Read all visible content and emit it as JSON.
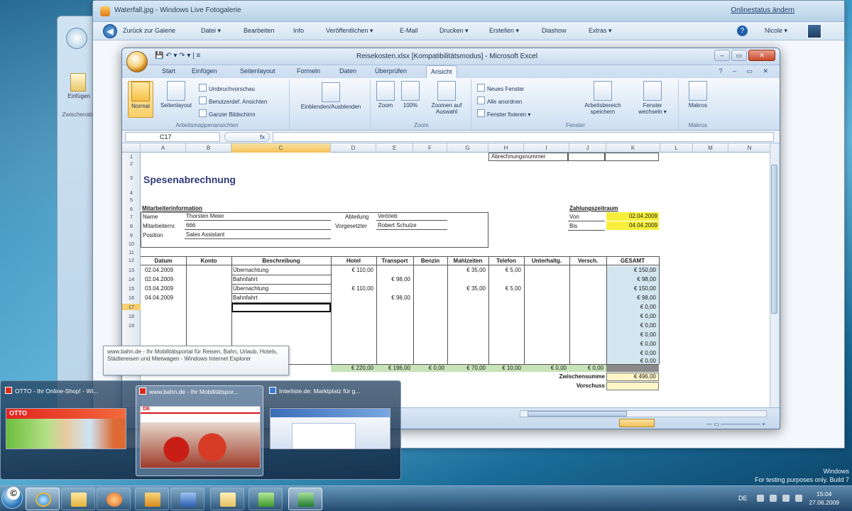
{
  "gallery": {
    "title": "Waterfall.jpg - Windows Live Fotogalerie",
    "online_link": "Onlinestatus ändern",
    "back_label": "Zurück zur Galerie",
    "menu": [
      "Datei ▾",
      "Bearbeiten",
      "Info",
      "Veröffentlichen ▾",
      "E-Mail",
      "Drucken ▾",
      "Erstellen ▾",
      "Diashow",
      "Extras ▾"
    ],
    "signin": "Nicole ▾",
    "side_label": "Einfügen",
    "side_label2": "Zwischenabl."
  },
  "excel": {
    "title": "Reisekosten.xlsx [Kompatibilitätsmodus] - Microsoft Excel",
    "qat": "💾 ↶ ▾  ↷ ▾  |  ≡",
    "tabs": [
      "Start",
      "Einfügen",
      "Seitenlayout",
      "Formeln",
      "Daten",
      "Überprüfen",
      "Ansicht"
    ],
    "active_tab": "Ansicht",
    "ribbon": {
      "normal": "Normal",
      "seitenlayout": "Seitenlayout",
      "umbruch": "Umbruchvorschau",
      "benutzer": "Benutzerdef. Ansichten",
      "ganzer": "Ganzer Bildschirm",
      "group1": "Arbeitsmappenansichten",
      "einblenden": "Einblenden/Ausblenden",
      "zoom": "Zoom",
      "hundred": "100%",
      "zoomsel": "Zoomen auf Auswahl",
      "group_zoom": "Zoom",
      "neues": "Neues Fenster",
      "alle": "Alle anordnen",
      "fixieren": "Fenster fixieren ▾",
      "arbeits": "Arbeitsbereich speichern",
      "wechseln": "Fenster wechseln ▾",
      "group_fenster": "Fenster",
      "makros": "Makros",
      "group_makros": "Makros"
    },
    "namebox": "C17",
    "fx": "fx",
    "columns": [
      "A",
      "B",
      "C",
      "D",
      "E",
      "F",
      "G",
      "H",
      "I",
      "J",
      "K",
      "L",
      "M",
      "N"
    ],
    "rows": [
      "1",
      "2",
      "3",
      "4",
      "5",
      "6",
      "7",
      "8",
      "9",
      "10",
      "11",
      "12",
      "13",
      "14",
      "15",
      "16",
      "17",
      "18",
      "19"
    ],
    "sheet": {
      "abrechnungsnummer": "Abrechnungsnummer",
      "title": "Spesenabrechnung",
      "mitarbeiter_header": "Mitarbeiterinformation",
      "name_label": "Name",
      "name_value": "Thorsten Meier",
      "mitarbeiternr_label": "Mitarbeiternr.",
      "mitarbeiternr_value": "666",
      "position_label": "Position",
      "position_value": "Sales Assistant",
      "abteilung_label": "Abteilung",
      "abteilung_value": "Vertrieb",
      "vorgesetzter_label": "Vorgesetzter",
      "vorgesetzter_value": "Robert Schulze",
      "zahlungszeitraum": "Zahlungszeitraum",
      "von_label": "Von",
      "von_value": "02.04.2009",
      "bis_label": "Bis",
      "bis_value": "04.04.2009",
      "headers": [
        "Datum",
        "Konto",
        "Beschreibung",
        "Hotel",
        "Transport",
        "Benzin",
        "Mahlzeiten",
        "Telefon",
        "Unterhaltg.",
        "Versch.",
        "GESAMT"
      ],
      "rows": [
        {
          "datum": "02.04.2009",
          "beschreibung": "Übernachtung",
          "hotel": "€ 110,00",
          "transport": "",
          "mahlzeiten": "€ 35,00",
          "telefon": "€ 5,00",
          "gesamt": "€ 150,00"
        },
        {
          "datum": "02.04.2009",
          "beschreibung": "Bahnfahrt",
          "hotel": "",
          "transport": "€ 98,00",
          "mahlzeiten": "",
          "telefon": "",
          "gesamt": "€ 98,00"
        },
        {
          "datum": "03.04.2009",
          "beschreibung": "Übernachtung",
          "hotel": "€ 110,00",
          "transport": "",
          "mahlzeiten": "€ 35,00",
          "telefon": "€ 5,00",
          "gesamt": "€ 150,00"
        },
        {
          "datum": "04.04.2009",
          "beschreibung": "Bahnfahrt",
          "hotel": "",
          "transport": "€ 98,00",
          "mahlzeiten": "",
          "telefon": "",
          "gesamt": "€ 98,00"
        }
      ],
      "zero": "€ 0,00",
      "totals": [
        "€ 220,00",
        "€ 196,00",
        "€ 0,00",
        "€ 70,00",
        "€ 10,00",
        "€ 0,00",
        "€ 0,00"
      ],
      "zwischensumme_label": "Zwischensumme",
      "zwischensumme_value": "€ 496,00",
      "vorschuss_label": "Vorschuss"
    }
  },
  "tooltip": "www.bahn.de - Ihr Mobilitätsportal für Reisen, Bahn, Urlaub, Hotels, Städtereisen und Mietwagen - Windows Internet Explorer",
  "previews": [
    {
      "title": "OTTO - Ihr Online-Shop! - Wi...",
      "logo": "OTTO"
    },
    {
      "title": "www.bahn.de - Ihr Mobilitätspor...",
      "logo": "DB"
    },
    {
      "title": "Interliste.de: Marktplatz für g..."
    }
  ],
  "tray": {
    "lang": "DE",
    "time": "15:04",
    "date": "27.06.2009"
  },
  "watermark": [
    "Windows",
    "For testing purposes only. Build 7"
  ],
  "copyright": "©"
}
